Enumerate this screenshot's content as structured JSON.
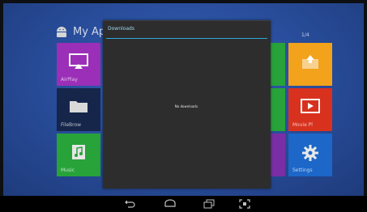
{
  "launcher": {
    "title": "My Apps",
    "page_indicator": "1/4",
    "tiles": [
      {
        "label": "AirPlay",
        "icon": "airplay-icon",
        "color": "#9b2fb8"
      },
      {
        "label": "FileBrow",
        "icon": "folder-icon",
        "color": "#16264a"
      },
      {
        "label": "Music",
        "icon": "music-file-icon",
        "color": "#27a33a"
      },
      {
        "label": "",
        "icon": "upload-icon",
        "color": "#f3a21b"
      },
      {
        "label": "Movie Pl",
        "icon": "video-play-icon",
        "color": "#d8321f"
      },
      {
        "label": "Settings",
        "icon": "gear-icon",
        "color": "#1c67c8"
      }
    ]
  },
  "dialog": {
    "title": "Downloads",
    "empty_message": "No downloads."
  },
  "navbar": {
    "buttons": [
      "back-icon",
      "home-icon",
      "recents-icon",
      "screenshot-icon"
    ]
  },
  "colors": {
    "accent": "#2fa7d8",
    "dialog_bg": "#2d2d2d"
  }
}
